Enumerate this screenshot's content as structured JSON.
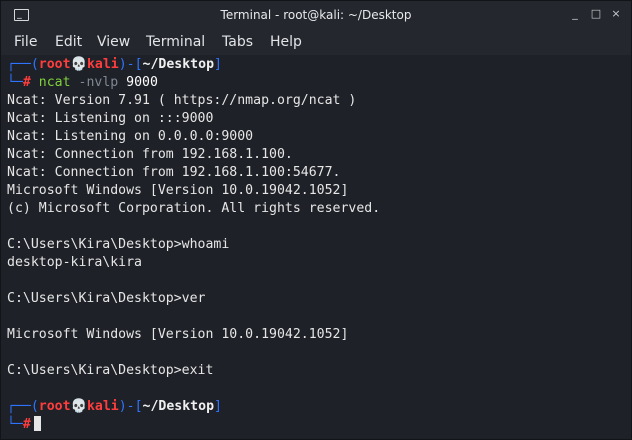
{
  "window": {
    "title": "Terminal - root@kali: ~/Desktop",
    "buttons": {
      "minimize": "_",
      "maximize": "□",
      "close": "×"
    }
  },
  "menu": [
    "File",
    "Edit",
    "View",
    "Terminal",
    "Tabs",
    "Help"
  ],
  "prompt": {
    "frame_top": "┌──(",
    "user": "root",
    "skull": "💀",
    "host": "kali",
    "middle": ")-[",
    "path": "~/Desktop",
    "close": "]",
    "frame_bottom": "└─",
    "hash": "#"
  },
  "command": {
    "name": "ncat",
    "args": "-nvlp",
    "port": "9000"
  },
  "output": [
    "Ncat: Version 7.91 ( https://nmap.org/ncat )",
    "Ncat: Listening on :::9000",
    "Ncat: Listening on 0.0.0.0:9000",
    "Ncat: Connection from 192.168.1.100.",
    "Ncat: Connection from 192.168.1.100:54677.",
    "Microsoft Windows [Version 10.0.19042.1052]",
    "(c) Microsoft Corporation. All rights reserved.",
    "",
    "C:\\Users\\Kira\\Desktop>whoami",
    "desktop-kira\\kira",
    "",
    "C:\\Users\\Kira\\Desktop>ver",
    "",
    "Microsoft Windows [Version 10.0.19042.1052]",
    "",
    "C:\\Users\\Kira\\Desktop>exit"
  ]
}
